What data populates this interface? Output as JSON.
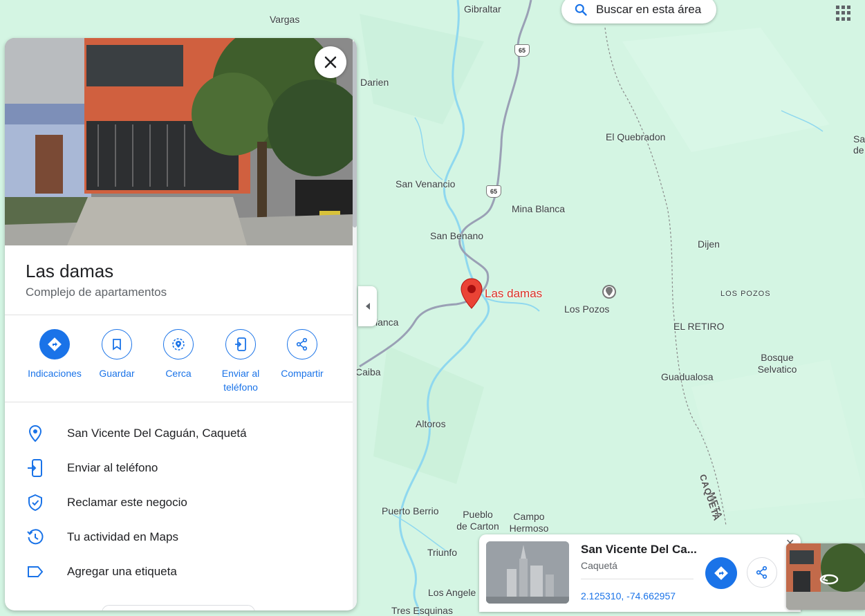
{
  "search": {
    "label": "Buscar en esta área"
  },
  "map": {
    "places": [
      {
        "key": "vargas",
        "name": "Vargas"
      },
      {
        "key": "gibraltar",
        "name": "Gibraltar"
      },
      {
        "key": "darien",
        "name": "Darien"
      },
      {
        "key": "el_quebradon",
        "name": "El Quebradon"
      },
      {
        "key": "san_venancio",
        "name": "San Venancio"
      },
      {
        "key": "mina_blanca",
        "name": "Mina Blanca"
      },
      {
        "key": "san_benano",
        "name": "San Benano"
      },
      {
        "key": "dijen",
        "name": "Dijen"
      },
      {
        "key": "los_pozos_area",
        "name": "LOS POZOS"
      },
      {
        "key": "los_pozos",
        "name": "Los Pozos"
      },
      {
        "key": "el_retiro",
        "name": "EL RETIRO"
      },
      {
        "key": "lanca",
        "name": "lanca"
      },
      {
        "key": "caiba",
        "name": "Caiba"
      },
      {
        "key": "bosque_selvatico",
        "name": "Bosque\nSelvatico"
      },
      {
        "key": "guadualosa",
        "name": "Guadualosa"
      },
      {
        "key": "altoros",
        "name": "Altoros"
      },
      {
        "key": "puerto_berrio",
        "name": "Puerto Berrio"
      },
      {
        "key": "pueblo_de_carton",
        "name": "Pueblo\nde Carton"
      },
      {
        "key": "campo_hermoso",
        "name": "Campo\nHermoso"
      },
      {
        "key": "triunfo",
        "name": "Triunfo"
      },
      {
        "key": "los_angeles",
        "name": "Los Angele"
      },
      {
        "key": "tres_esquinas",
        "name": "Tres Esquinas"
      },
      {
        "key": "sa_de",
        "name": "Sa\nde"
      }
    ],
    "highway_number": "65",
    "boundary_labels": {
      "meta": "META",
      "caqueta": "CAQUETA"
    },
    "marker_label": "Las damas",
    "colors": {
      "land": "#d4f5e3",
      "water": "#8fd8ef",
      "road": "#9aa0b5",
      "marker": "#ea4335"
    }
  },
  "panel": {
    "title": "Las damas",
    "subtitle": "Complejo de apartamentos",
    "actions": [
      {
        "label": "Indicaciones",
        "icon": "directions-icon"
      },
      {
        "label": "Guardar",
        "icon": "bookmark-icon"
      },
      {
        "label": "Cerca",
        "icon": "nearby-icon"
      },
      {
        "label": "Enviar al teléfono",
        "icon": "send-to-phone-icon"
      },
      {
        "label": "Compartir",
        "icon": "share-icon"
      }
    ],
    "details": [
      {
        "text": "San Vicente Del Caguán, Caquetá",
        "icon": "location-pin-icon"
      },
      {
        "text": "Enviar al teléfono",
        "icon": "send-to-phone-icon"
      },
      {
        "text": "Reclamar este negocio",
        "icon": "verified-shield-icon"
      },
      {
        "text": "Tu actividad en Maps",
        "icon": "history-icon"
      },
      {
        "text": "Agregar una etiqueta",
        "icon": "label-icon"
      }
    ]
  },
  "card": {
    "title": "San Vicente Del Ca...",
    "subtitle": "Caquetá",
    "coords": "2.125310, -74.662957"
  }
}
